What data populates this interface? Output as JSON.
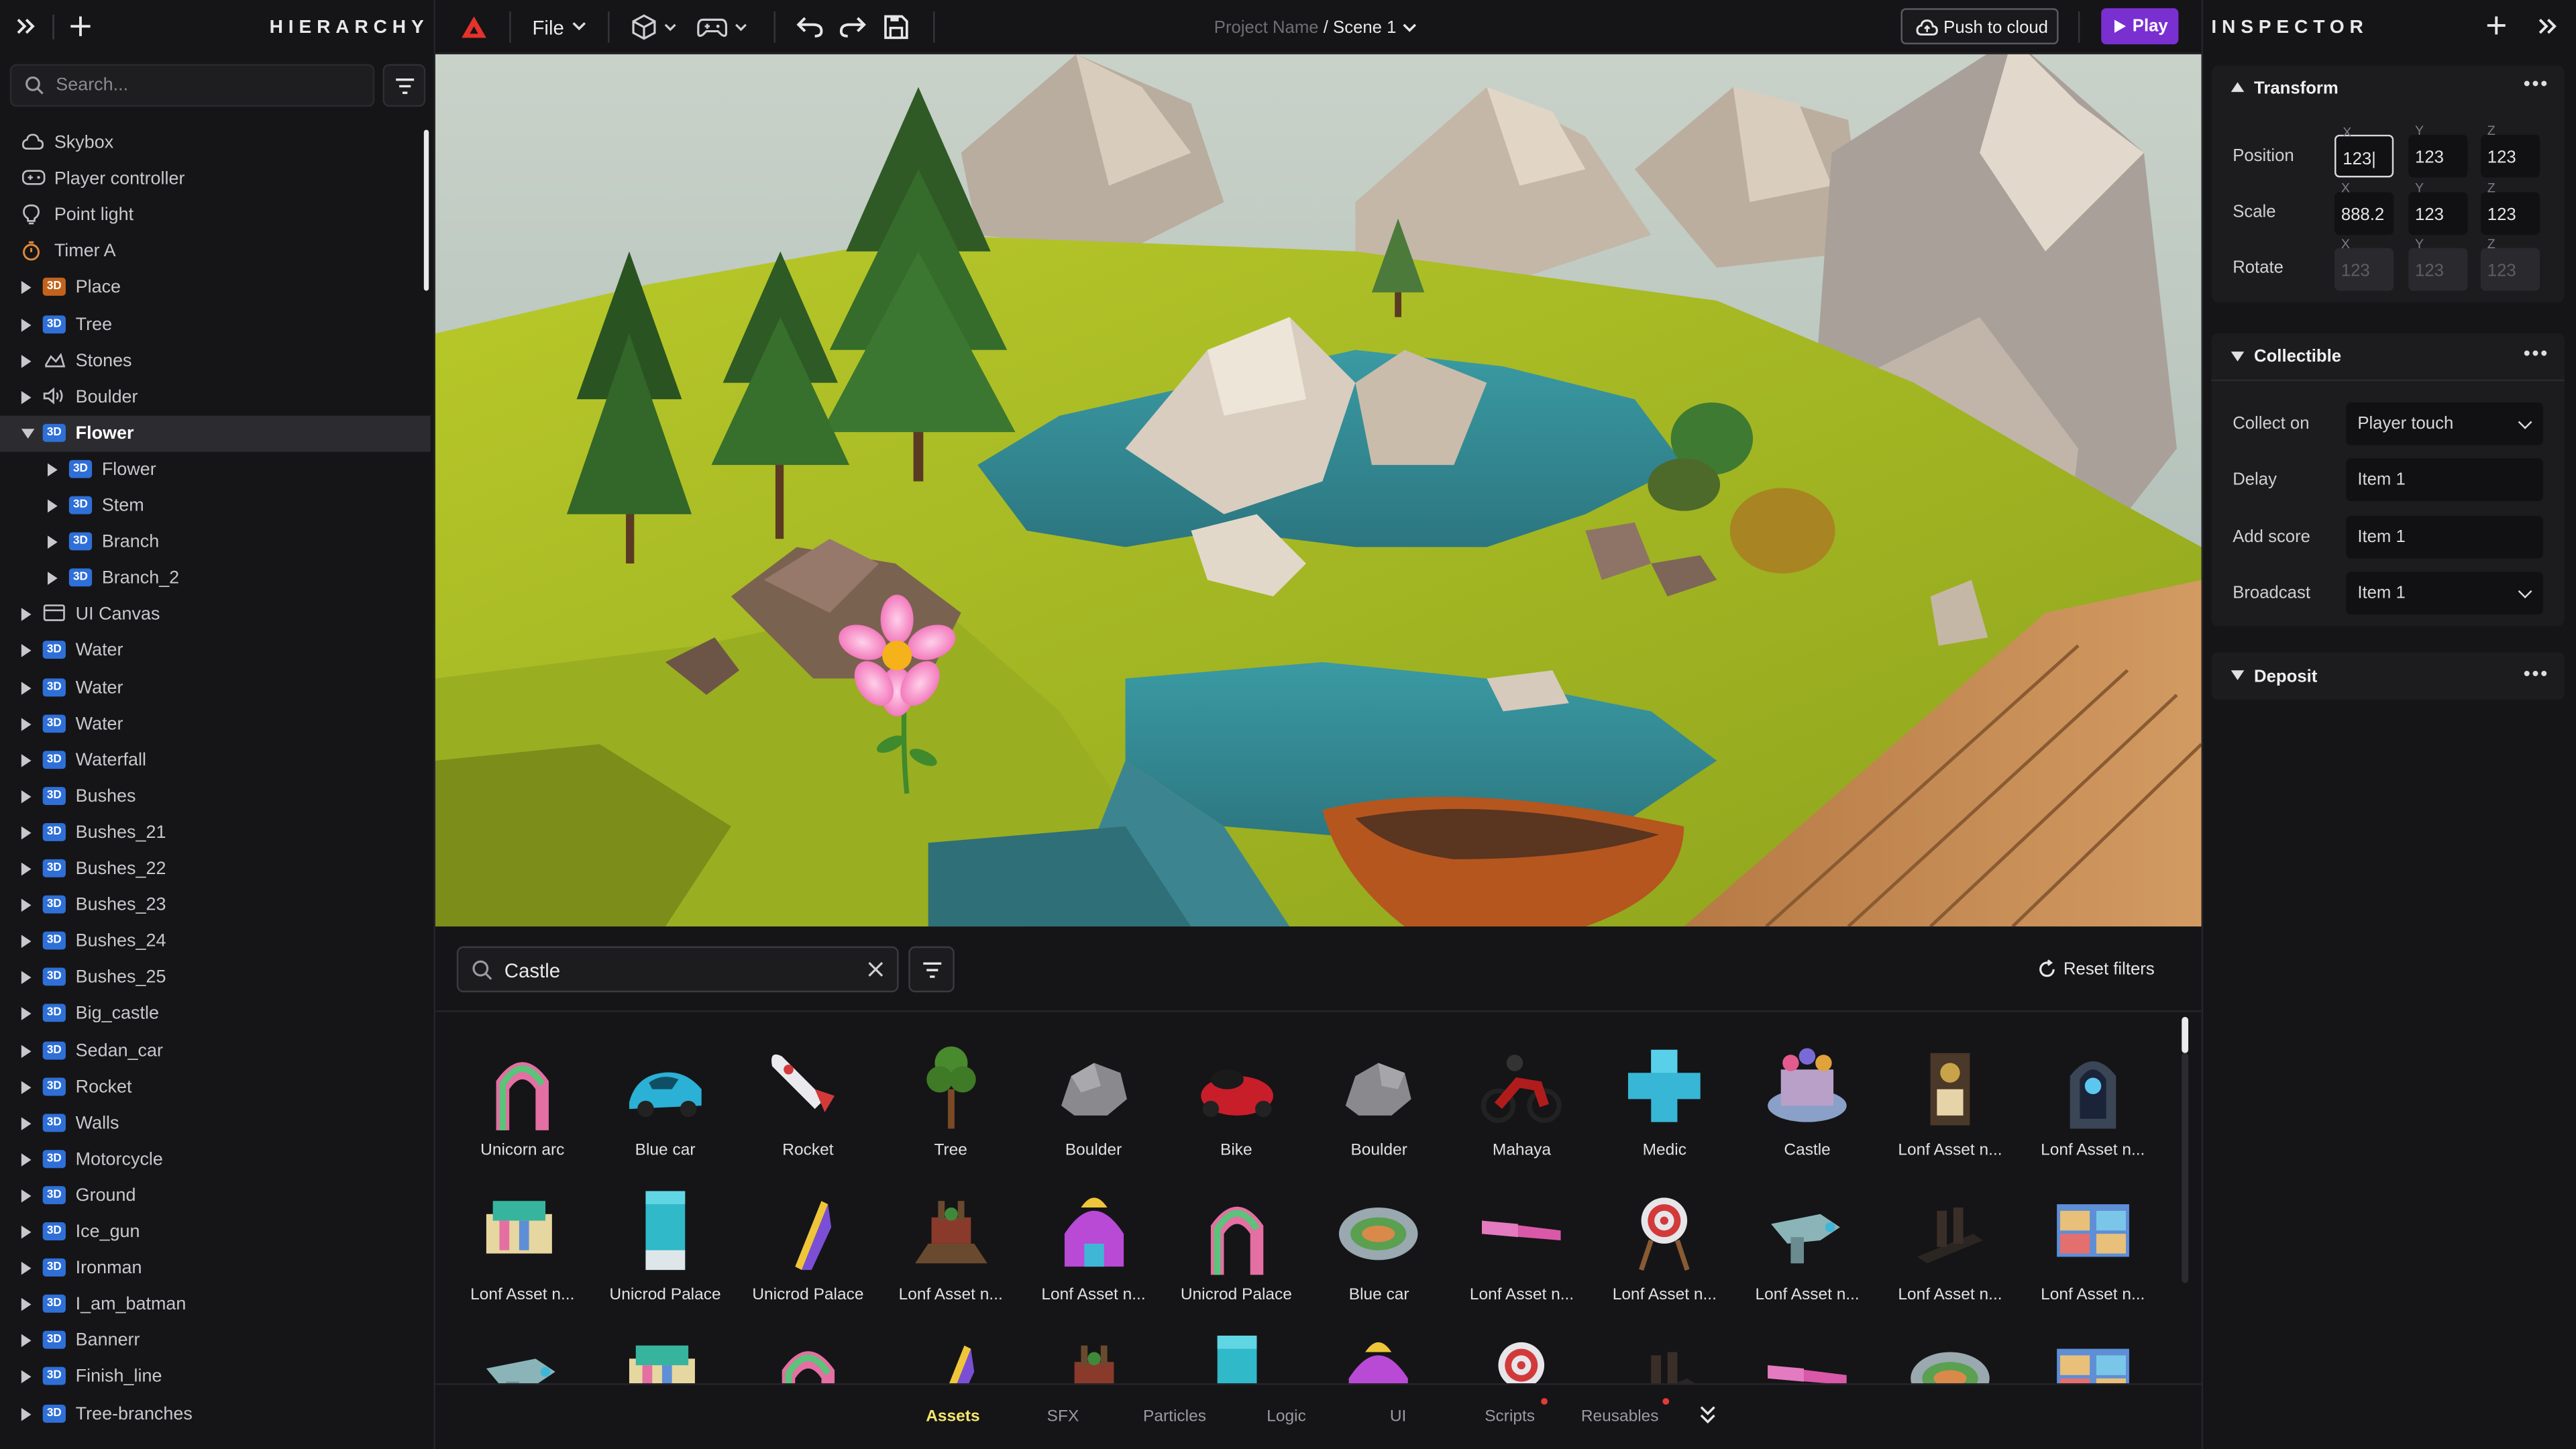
{
  "hierarchy": {
    "title": "HIERARCHY",
    "search_placeholder": "Search...",
    "items": [
      {
        "label": "Skybox",
        "icon": "cloud-icon"
      },
      {
        "label": "Player controller",
        "icon": "gamepad-icon"
      },
      {
        "label": "Point light",
        "icon": "bulb-icon"
      },
      {
        "label": "Timer A",
        "icon": "timer-icon"
      },
      {
        "label": "Place",
        "icon": "3d-badge",
        "badge_color": "#c2631d"
      },
      {
        "label": "Tree",
        "icon": "3d-badge"
      },
      {
        "label": "Stones",
        "icon": "stones-icon"
      },
      {
        "label": "Boulder",
        "icon": "audio-icon"
      },
      {
        "label": "Flower",
        "icon": "3d-badge",
        "selected": true
      },
      {
        "label": "Flower",
        "icon": "3d-badge"
      },
      {
        "label": "Stem",
        "icon": "3d-badge"
      },
      {
        "label": "Branch",
        "icon": "3d-badge"
      },
      {
        "label": "Branch_2",
        "icon": "3d-badge"
      },
      {
        "label": "UI Canvas",
        "icon": "canvas-icon"
      },
      {
        "label": "Water",
        "icon": "3d-badge"
      },
      {
        "label": "Water",
        "icon": "3d-badge"
      },
      {
        "label": "Water",
        "icon": "3d-badge"
      },
      {
        "label": "Waterfall",
        "icon": "3d-badge"
      },
      {
        "label": "Bushes",
        "icon": "3d-badge"
      },
      {
        "label": "Bushes_21",
        "icon": "3d-badge"
      },
      {
        "label": "Bushes_22",
        "icon": "3d-badge"
      },
      {
        "label": "Bushes_23",
        "icon": "3d-badge"
      },
      {
        "label": "Bushes_24",
        "icon": "3d-badge"
      },
      {
        "label": "Bushes_25",
        "icon": "3d-badge"
      },
      {
        "label": "Big_castle",
        "icon": "3d-badge"
      },
      {
        "label": "Sedan_car",
        "icon": "3d-badge"
      },
      {
        "label": "Rocket",
        "icon": "3d-badge"
      },
      {
        "label": "Walls",
        "icon": "3d-badge"
      },
      {
        "label": "Motorcycle",
        "icon": "3d-badge"
      },
      {
        "label": "Ground",
        "icon": "3d-badge"
      },
      {
        "label": "Ice_gun",
        "icon": "3d-badge"
      },
      {
        "label": "Ironman",
        "icon": "3d-badge"
      },
      {
        "label": "I_am_batman",
        "icon": "3d-badge"
      },
      {
        "label": "Bannerr",
        "icon": "3d-badge"
      },
      {
        "label": "Finish_line",
        "icon": "3d-badge"
      },
      {
        "label": "Tree-branches",
        "icon": "3d-badge"
      }
    ]
  },
  "toolbar": {
    "file_menu": "File",
    "project_name": "Project Name",
    "separator": "/",
    "scene_name": "Scene 1",
    "push_label": "Push to cloud",
    "play_label": "Play",
    "brand_color": "#e5322d",
    "play_color": "#7a2fd1"
  },
  "inspector": {
    "title": "INSPECTOR",
    "transform": {
      "title": "Transform",
      "axis_x": "X",
      "axis_y": "Y",
      "axis_z": "Z",
      "position_label": "Position",
      "position": [
        "123|",
        "123",
        "123"
      ],
      "scale_label": "Scale",
      "scale": [
        "888.2",
        "123",
        "123"
      ],
      "rotate_label": "Rotate",
      "rotate": [
        "123",
        "123",
        "123"
      ]
    },
    "collectible": {
      "title": "Collectible",
      "collect_on_label": "Collect on",
      "collect_on_value": "Player touch",
      "delay_label": "Delay",
      "delay_value": "Item 1",
      "add_score_label": "Add score",
      "add_score_value": "Item 1",
      "broadcast_label": "Broadcast",
      "broadcast_value": "Item 1"
    },
    "deposit": {
      "title": "Deposit"
    }
  },
  "assets": {
    "search_value": "Castle",
    "reset_label": "Reset filters",
    "row1": [
      "Unicorn arc",
      "Blue car",
      "Rocket",
      "Tree",
      "Boulder",
      "Bike",
      "Boulder",
      "Mahaya",
      "Medic",
      "Castle",
      "Lonf Asset n...",
      "Lonf Asset n..."
    ],
    "row2": [
      "Lonf Asset n...",
      "Unicrod Palace",
      "Unicrod Palace",
      "Lonf Asset n...",
      "Lonf Asset n...",
      "Unicrod Palace",
      "Blue car",
      "Lonf Asset n...",
      "Lonf Asset n...",
      "Lonf Asset n...",
      "Lonf Asset n...",
      "Lonf Asset n..."
    ],
    "tabs": [
      "Assets",
      "SFX",
      "Particles",
      "Logic",
      "UI",
      "Scripts",
      "Reusables"
    ],
    "active_tab": "Assets"
  }
}
